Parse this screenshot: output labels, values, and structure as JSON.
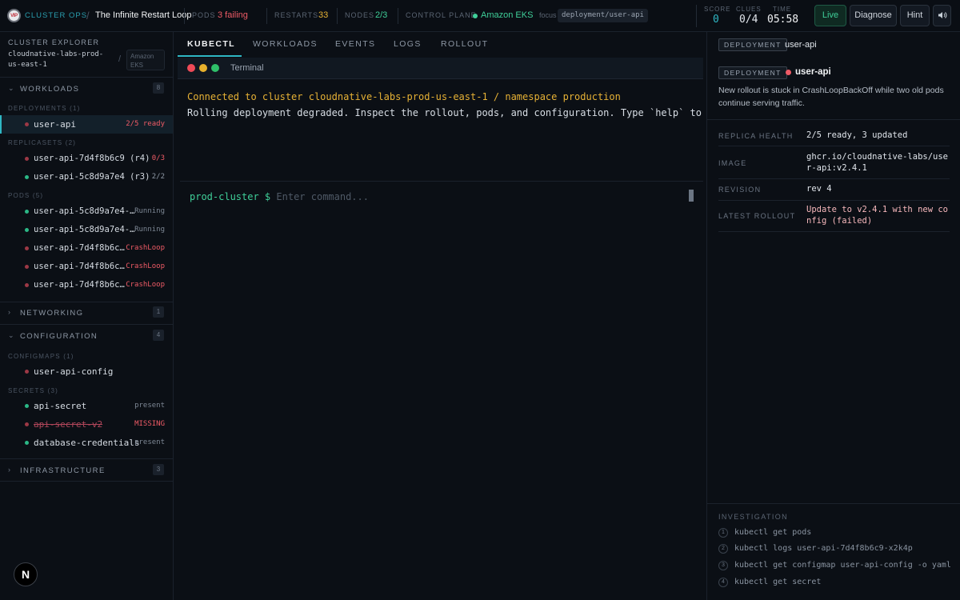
{
  "colors": {
    "accent": "#2fb7c4",
    "danger": "#ef5b66",
    "warning": "#e6b135",
    "success": "#3fcf99",
    "background": "#0b0f15"
  },
  "header": {
    "logo_text": "VIP",
    "brand": "CLUSTER OPS",
    "separator": "/",
    "scenario_title": "The Infinite Restart Loop",
    "pods_label": "PODS",
    "pods_value": "3 failing",
    "restarts_label": "RESTARTS",
    "restarts_value": "33",
    "nodes_label": "NODES",
    "nodes_value": "2/3",
    "control_plane_label": "CONTROL PLANE",
    "control_plane_value": "Amazon EKS",
    "focus_label": "focus",
    "focus_value": "deployment/user-api",
    "score_label": "SCORE",
    "score_value": "0",
    "clues_label": "CLUES",
    "clues_value": "0/4",
    "time_label": "TIME",
    "time_value": "05:58",
    "live_button": "Live",
    "diagnose_button": "Diagnose",
    "hint_button": "Hint",
    "sound_icon": "speaker-icon"
  },
  "sidebar": {
    "title": "CLUSTER EXPLORER",
    "cluster_name": "cloudnative-labs-prod-us-east-1",
    "slash": "/",
    "provider": "Amazon EKS",
    "sections": {
      "workloads": {
        "label": "WORKLOADS",
        "count": "8"
      },
      "networking": {
        "label": "NETWORKING",
        "count": "1"
      },
      "configuration": {
        "label": "CONFIGURATION",
        "count": "4"
      },
      "infrastructure": {
        "label": "INFRASTRUCTURE",
        "count": "3"
      }
    },
    "groups": {
      "deployments": "DEPLOYMENTS (1)",
      "replicasets": "REPLICASETS (2)",
      "pods": "PODS (5)",
      "configmaps": "CONFIGMAPS (1)",
      "secrets": "SECRETS (3)"
    },
    "deployments": [
      {
        "name": "user-api",
        "status": "2/5 ready"
      }
    ],
    "replicasets": [
      {
        "name": "user-api-7d4f8b6c9 (r4)",
        "status": "0/3"
      },
      {
        "name": "user-api-5c8d9a7e4 (r3)",
        "status": "2/2"
      }
    ],
    "pods": [
      {
        "name": "user-api-5c8d9a7e4-…",
        "status": "Running"
      },
      {
        "name": "user-api-5c8d9a7e4-…",
        "status": "Running"
      },
      {
        "name": "user-api-7d4f8b6c…",
        "status": "CrashLoop"
      },
      {
        "name": "user-api-7d4f8b6c…",
        "status": "CrashLoop"
      },
      {
        "name": "user-api-7d4f8b6c…",
        "status": "CrashLoop"
      }
    ],
    "configmaps": [
      {
        "name": "user-api-config"
      }
    ],
    "secrets": [
      {
        "name": "api-secret",
        "status": "present"
      },
      {
        "name": "api-secret-v2",
        "status": "MISSING"
      },
      {
        "name": "database-credentials",
        "status": "present"
      }
    ],
    "footer_badge": "N"
  },
  "center": {
    "tabs": [
      "KUBECTL",
      "WORKLOADS",
      "EVENTS",
      "LOGS",
      "ROLLOUT"
    ],
    "terminal_title": "Terminal",
    "line1": "Connected to cluster cloudnative-labs-prod-us-east-1 / namespace production",
    "line2": "Rolling deployment degraded. Inspect the rollout, pods, and configuration. Type `help` to begin.",
    "prompt_host": "prod-cluster $",
    "prompt_placeholder": "Enter command..."
  },
  "details": {
    "top_kind": "DEPLOYMENT",
    "top_name": "user-api",
    "kind": "DEPLOYMENT",
    "name": "user-api",
    "description": "New rollout is stuck in CrashLoopBackOff while two old pods continue serving traffic.",
    "fields": [
      {
        "label": "REPLICA HEALTH",
        "value": "2/5 ready, 3 updated"
      },
      {
        "label": "IMAGE",
        "value": "ghcr.io/cloudnative-labs/user-api:v2.4.1"
      },
      {
        "label": "REVISION",
        "value": "rev 4"
      },
      {
        "label": "LATEST ROLLOUT",
        "value": "Update to v2.4.1 with new config (failed)"
      }
    ]
  },
  "investigation": {
    "title": "INVESTIGATION",
    "steps": [
      {
        "num": "1",
        "cmd": "kubectl get pods"
      },
      {
        "num": "2",
        "cmd": "kubectl logs user-api-7d4f8b6c9-x2k4p"
      },
      {
        "num": "3",
        "cmd": "kubectl get configmap user-api-config -o yaml"
      },
      {
        "num": "4",
        "cmd": "kubectl get secret"
      }
    ]
  }
}
